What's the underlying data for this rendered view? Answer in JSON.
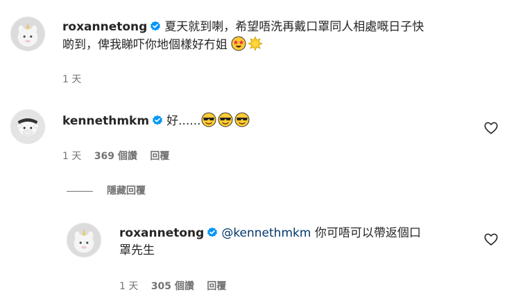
{
  "comments": [
    {
      "username": "roxannetong",
      "text_line1": "夏天就到喇，希望唔洗再戴口罩同人相處嘅日子快",
      "text_line2": "啲到，俾我睇吓你地個樣好冇姐",
      "emojis": [
        "star-struck-emoji",
        "sun-emoji"
      ],
      "time": "1 天"
    },
    {
      "username": "kennethmkm",
      "text": "好......",
      "emojis": [
        "sunglasses-emoji",
        "sunglasses-emoji",
        "sunglasses-emoji"
      ],
      "time": "1 天",
      "likes": "369 個讚",
      "reply_label": "回覆"
    }
  ],
  "hide_replies_label": "隱藏回覆",
  "reply": {
    "username": "roxannetong",
    "mention": "@kennethmkm",
    "text_line1": " 你可唔可以帶返個口",
    "text_line2": "罩先生",
    "time": "1 天",
    "likes": "305 個讚",
    "reply_label": "回覆"
  },
  "colors": {
    "verified": "#0095f6",
    "mention": "#00376b",
    "meta": "#737373"
  }
}
